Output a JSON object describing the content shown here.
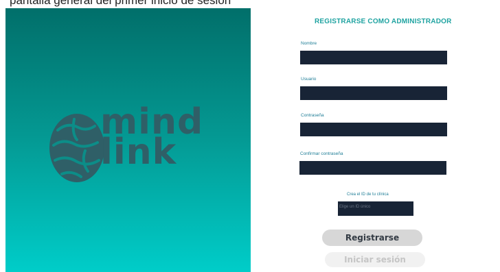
{
  "header": {
    "partial_text": "pantalla general del primer inicio de sesion"
  },
  "branding": {
    "line1": "mind",
    "line2": "link",
    "colors": {
      "panel_top": "#016f6a",
      "panel_bottom": "#00cdc9",
      "logo": "#2f5f67"
    }
  },
  "form": {
    "title": "REGISTRARSE COMO ADMINISTRADOR",
    "fields": [
      {
        "label": "Nombre",
        "value": ""
      },
      {
        "label": "Usuario",
        "value": ""
      },
      {
        "label": "Contraseña",
        "value": ""
      },
      {
        "label": "Confirmar contraseña",
        "value": ""
      }
    ],
    "clinic_id": {
      "caption": "Crea el ID de tu clínica",
      "placeholder": "Elige un ID único"
    },
    "register_label": "Registrarse",
    "login_label": "Iniciar sesión",
    "colors": {
      "input_bg": "#182436",
      "title": "#1fa3a1",
      "label": "#1e7d96"
    }
  }
}
